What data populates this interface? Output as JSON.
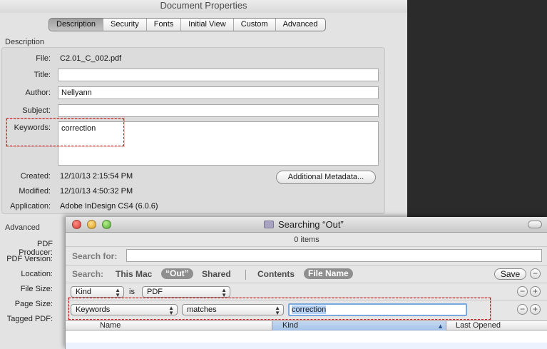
{
  "doc_properties": {
    "title": "Document Properties",
    "tabs": [
      "Description",
      "Security",
      "Fonts",
      "Initial View",
      "Custom",
      "Advanced"
    ],
    "active_tab": "Description",
    "description_section": "Description",
    "file_label": "File:",
    "file_value": "C2.01_C_002.pdf",
    "title_label": "Title:",
    "title_value": "",
    "author_label": "Author:",
    "author_value": "Nellyann",
    "subject_label": "Subject:",
    "subject_value": "",
    "keywords_label": "Keywords:",
    "keywords_value": "correction",
    "created_label": "Created:",
    "created_value": "12/10/13 2:15:54 PM",
    "modified_label": "Modified:",
    "modified_value": "12/10/13 4:50:32 PM",
    "application_label": "Application:",
    "application_value": "Adobe InDesign CS4 (6.0.6)",
    "additional_metadata_button": "Additional Metadata...",
    "advanced_section": "Advanced",
    "pdf_producer_label": "PDF Producer:",
    "pdf_version_label": "PDF Version:",
    "location_label": "Location:",
    "file_size_label": "File Size:",
    "page_size_label": "Page Size:",
    "tagged_pdf_label": "Tagged PDF:"
  },
  "finder_search": {
    "title": "Searching “Out”",
    "items_count": "0 items",
    "search_for_label": "Search for:",
    "search_for_value": "",
    "search_label": "Search:",
    "scope_this_mac": "This Mac",
    "scope_out": "“Out”",
    "scope_shared": "Shared",
    "contents_label": "Contents",
    "file_name_label": "File Name",
    "save_button": "Save",
    "minus": "−",
    "plus": "+",
    "criteria": [
      {
        "attribute": "Kind",
        "operator": "is",
        "value": "PDF"
      },
      {
        "attribute": "Keywords",
        "operator": "matches",
        "value": "correction"
      }
    ],
    "columns": [
      "Name",
      "Kind",
      "Last Opened"
    ],
    "sorted_column": "Kind"
  },
  "colors": {
    "highlight_border": "#c41a1a",
    "selected_tab": "#9e9e9e",
    "sorted_column": "#a6c3e8",
    "focus_ring": "#7ba7e0"
  },
  "icons": {
    "folder": "smart-folder-icon",
    "sort": "sort-ascending-icon"
  }
}
